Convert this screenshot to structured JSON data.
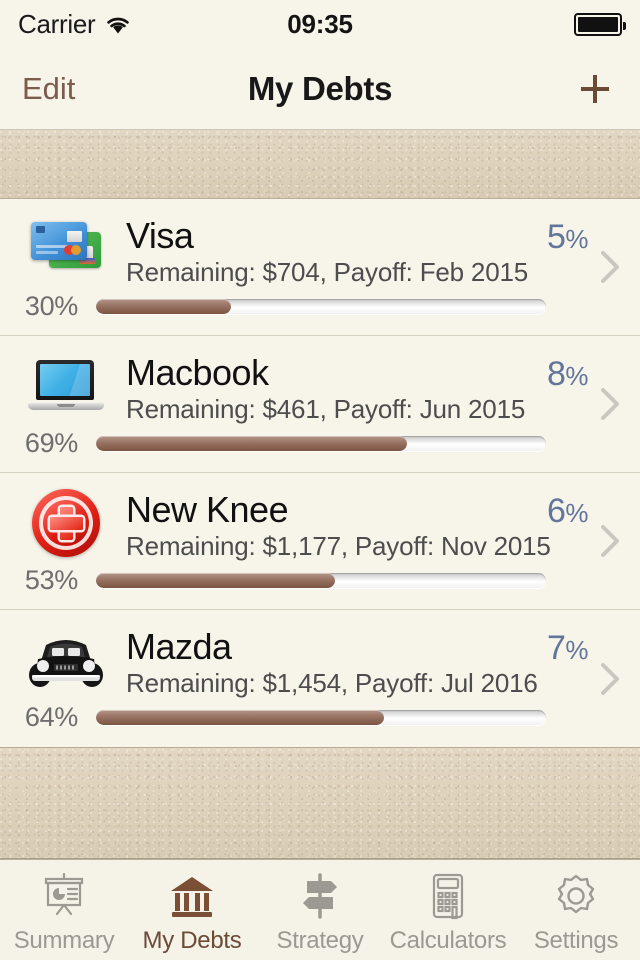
{
  "status_bar": {
    "carrier": "Carrier",
    "wifi_icon": "wifi-icon",
    "time": "09:35",
    "battery_icon": "battery-full-icon"
  },
  "nav_bar": {
    "edit_label": "Edit",
    "title": "My Debts",
    "add_icon": "plus-icon"
  },
  "debts": [
    {
      "icon": "credit-cards-icon",
      "name": "Visa",
      "detail": "Remaining: $704, Payoff: Feb 2015",
      "rate_value": "5",
      "rate_unit": "%",
      "progress_label": "30%",
      "progress_percent": 30,
      "chevron_icon": "chevron-right-icon"
    },
    {
      "icon": "laptop-icon",
      "name": "Macbook",
      "detail": "Remaining: $461, Payoff: Jun 2015",
      "rate_value": "8",
      "rate_unit": "%",
      "progress_label": "69%",
      "progress_percent": 69,
      "chevron_icon": "chevron-right-icon"
    },
    {
      "icon": "medical-cross-icon",
      "name": "New Knee",
      "detail": "Remaining: $1,177, Payoff: Nov 2015",
      "rate_value": "6",
      "rate_unit": "%",
      "progress_label": "53%",
      "progress_percent": 53,
      "chevron_icon": "chevron-right-icon"
    },
    {
      "icon": "car-icon",
      "name": "Mazda",
      "detail": "Remaining: $1,454, Payoff: Jul 2016",
      "rate_value": "7",
      "rate_unit": "%",
      "progress_label": "64%",
      "progress_percent": 64,
      "chevron_icon": "chevron-right-icon"
    }
  ],
  "tab_bar": {
    "tabs": [
      {
        "label": "Summary",
        "icon": "presentation-chart-icon",
        "active": false
      },
      {
        "label": "My Debts",
        "icon": "bank-icon",
        "active": true
      },
      {
        "label": "Strategy",
        "icon": "signpost-icon",
        "active": false
      },
      {
        "label": "Calculators",
        "icon": "calculator-icon",
        "active": false
      },
      {
        "label": "Settings",
        "icon": "gear-icon",
        "active": false
      }
    ]
  },
  "colors": {
    "accent_brown": "#7d5c4e",
    "rate_blue": "#62759a",
    "progress_fill": "#8a6250",
    "background": "#f7f4ea",
    "texture_band": "#ded2bc",
    "tab_inactive": "#9a9a93",
    "tab_active": "#6b4a36"
  }
}
